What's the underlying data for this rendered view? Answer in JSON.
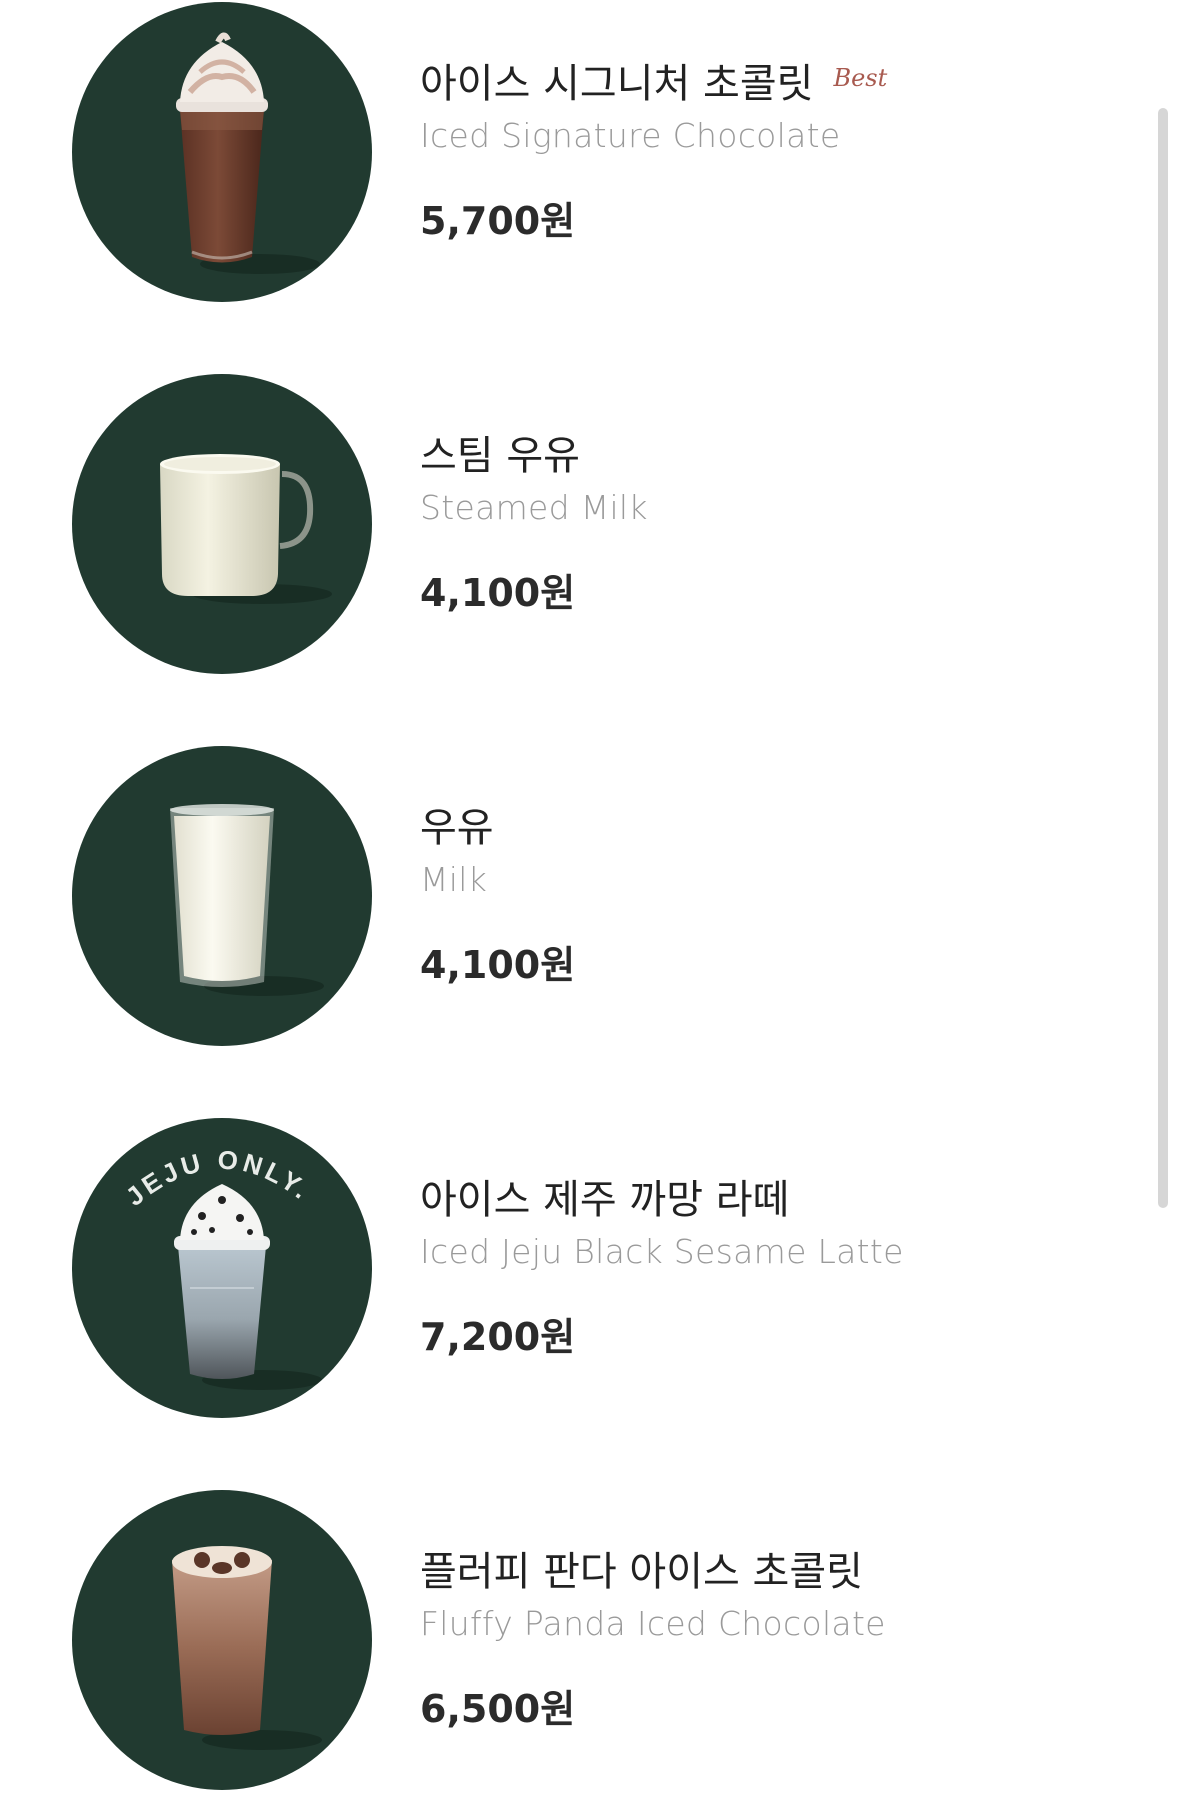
{
  "menu": {
    "items": [
      {
        "name_ko": "아이스 시그니처 초콜릿",
        "name_en": "Iced Signature Chocolate",
        "price": "5,700원",
        "badge": "Best",
        "image": "iced-chocolate-image"
      },
      {
        "name_ko": "스팀 우유",
        "name_en": "Steamed Milk",
        "price": "4,100원",
        "badge": "",
        "image": "steamed-milk-mug-image"
      },
      {
        "name_ko": "우유",
        "name_en": "Milk",
        "price": "4,100원",
        "badge": "",
        "image": "milk-glass-image"
      },
      {
        "name_ko": "아이스 제주 까망 라떼",
        "name_en": "Iced Jeju Black Sesame Latte",
        "price": "7,200원",
        "badge": "",
        "image": "jeju-black-sesame-latte-image",
        "image_text": "JEJU ONLY."
      },
      {
        "name_ko": "플러피 판다 아이스 초콜릿",
        "name_en": "Fluffy Panda Iced Chocolate",
        "price": "6,500원",
        "badge": "",
        "image": "fluffy-panda-chocolate-image"
      }
    ]
  },
  "colors": {
    "thumb_background": "#213a30",
    "name_text": "#222222",
    "english_text": "#9a9a9a",
    "price_text": "#2b2b2b",
    "best_badge": "#a85a4f",
    "scrollbar": "#d6d6d6"
  }
}
